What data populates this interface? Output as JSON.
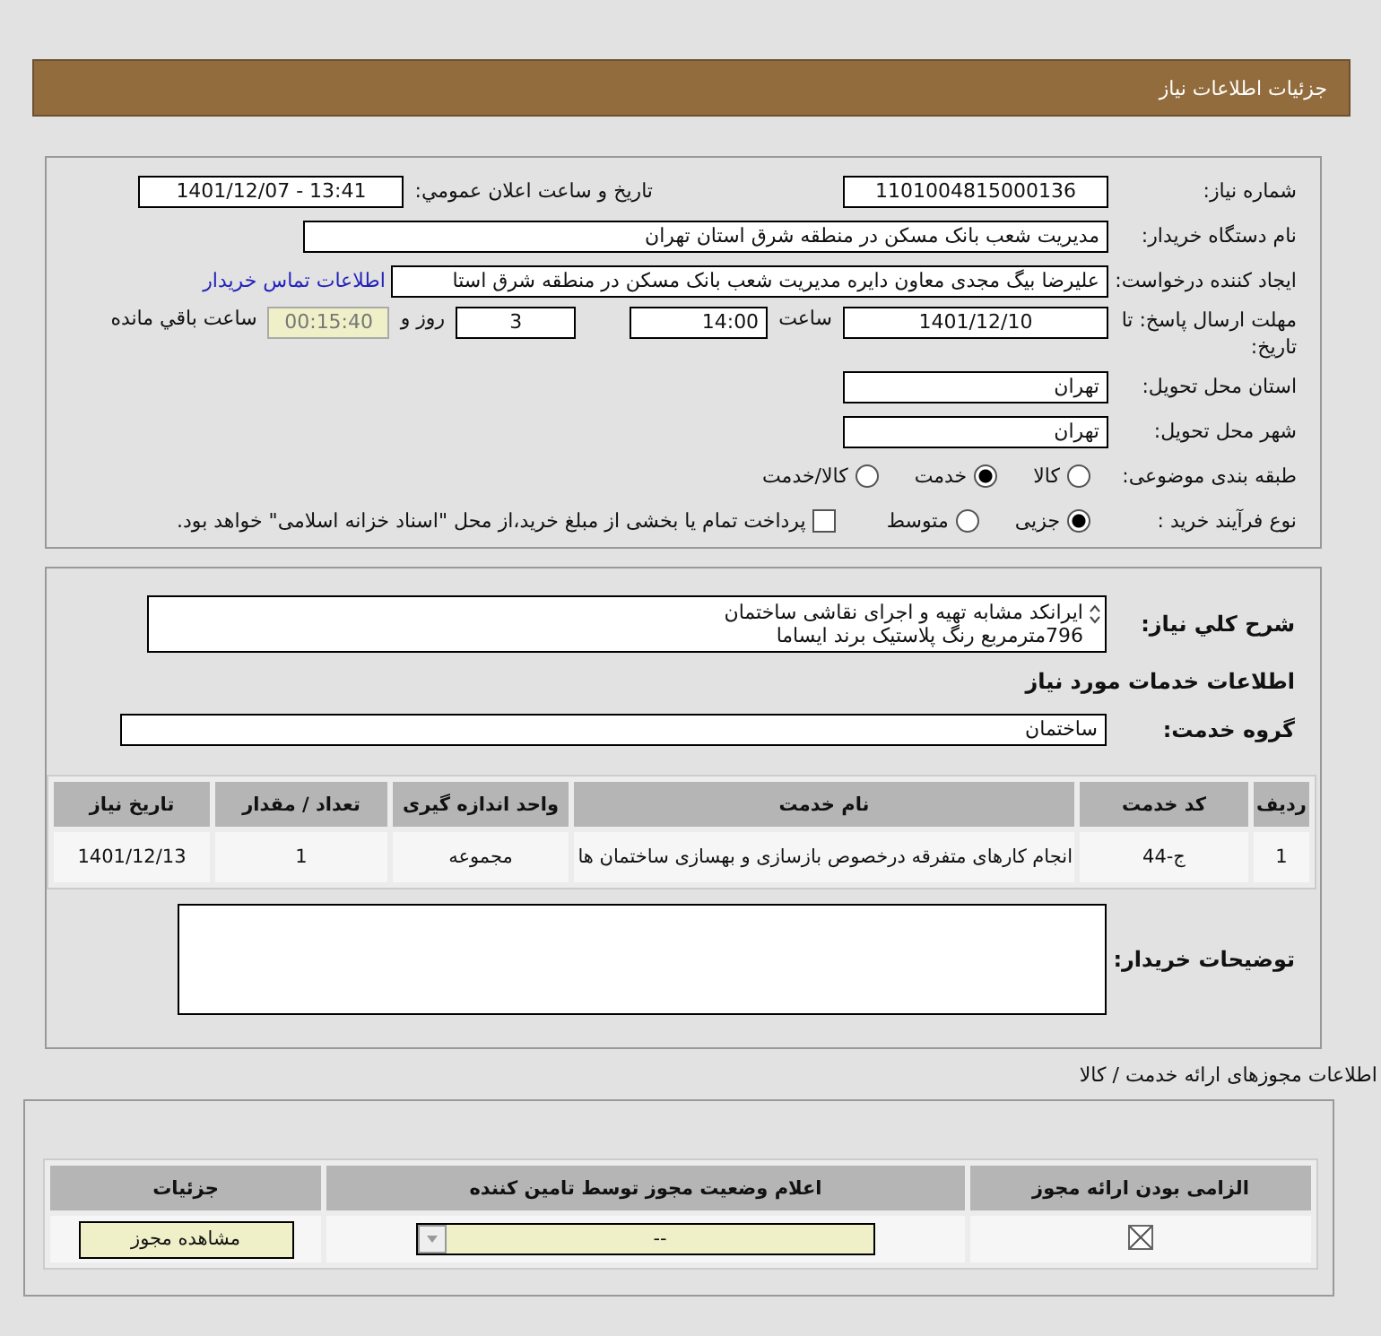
{
  "header": {
    "title": "جزئیات اطلاعات نیاز"
  },
  "details": {
    "need_number": {
      "label": "شماره نیاز:",
      "value": "1101004815000136"
    },
    "announce": {
      "label": "تاریخ و ساعت اعلان عمومي:",
      "value": "1401/12/07 - 13:41"
    },
    "buyer": {
      "label": "نام دستگاه خریدار:",
      "value": "مدیریت شعب بانک مسکن در منطقه شرق استان تهران"
    },
    "creator": {
      "label": "ایجاد کننده درخواست:",
      "value": "علیرضا بیگ مجدی معاون دایره مدیریت شعب بانک مسکن در منطقه شرق استا",
      "link": "اطلاعات تماس خریدار"
    },
    "deadline": {
      "label": "مهلت ارسال پاسخ: تا تاریخ:",
      "date": "1401/12/10",
      "time_label": "ساعت",
      "time": "14:00",
      "days": "3",
      "days_label": "روز و",
      "remaining": "00:15:40",
      "remaining_label": "ساعت باقي مانده"
    },
    "province": {
      "label": "استان محل تحویل:",
      "value": "تهران"
    },
    "city": {
      "label": "شهر محل تحویل:",
      "value": "تهران"
    },
    "category": {
      "label": "طبقه بندی موضوعی:",
      "options": [
        {
          "label": "کالا",
          "selected": false
        },
        {
          "label": "خدمت",
          "selected": true
        },
        {
          "label": "کالا/خدمت",
          "selected": false
        }
      ]
    },
    "process": {
      "label": "نوع فرآیند خرید :",
      "options": [
        {
          "label": "جزیی",
          "selected": true
        },
        {
          "label": "متوسط",
          "selected": false
        }
      ],
      "treasury": {
        "label": "پرداخت تمام یا بخشی از مبلغ خرید،از محل \"اسناد خزانه اسلامی\" خواهد بود.",
        "checked": false
      }
    }
  },
  "need": {
    "description": {
      "label": "شرح کلي نیاز:",
      "lines": [
        "ایرانکد مشابه تهیه و اجرای نقاشی ساختمان",
        "796مترمربع رنگ پلاستیک برند ایساما"
      ]
    },
    "services_title": "اطلاعات خدمات مورد نیاز",
    "group": {
      "label": "گروه خدمت:",
      "value": "ساختمان"
    },
    "table": {
      "columns": [
        "ردیف",
        "کد خدمت",
        "نام خدمت",
        "واحد اندازه گیری",
        "تعداد / مقدار",
        "تاریخ نیاز"
      ],
      "rows": [
        [
          "1",
          "ج-44",
          "انجام کارهای متفرقه درخصوص بازسازی و بهسازی ساختمان ها",
          "مجموعه",
          "1",
          "1401/12/13"
        ]
      ]
    },
    "buyer_notes": {
      "label": "توضیحات خریدار:"
    }
  },
  "permits": {
    "title": "اطلاعات مجوزهای ارائه خدمت / کالا",
    "table": {
      "columns": [
        "الزامی بودن ارائه مجوز",
        "اعلام وضعیت مجوز توسط تامین کننده",
        "جزئیات"
      ],
      "rows": [
        {
          "required": true,
          "status": "--",
          "action": "مشاهده مجوز"
        }
      ]
    }
  }
}
